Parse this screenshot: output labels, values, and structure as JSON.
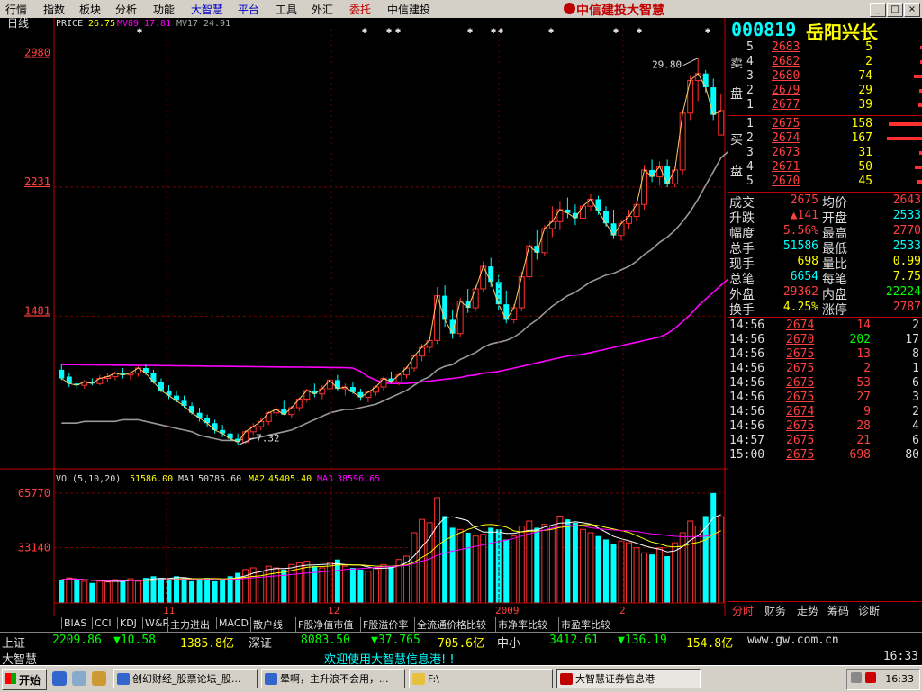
{
  "menu": {
    "items": [
      "行情",
      "指数",
      "板块",
      "分析",
      "功能",
      "大智慧",
      "平台",
      "工具",
      "外汇",
      "委托",
      "中信建投"
    ],
    "highlight": [
      "大智慧",
      "平台"
    ],
    "red": [
      "委托"
    ]
  },
  "brand": "中信建投大智慧",
  "window_buttons": [
    "_",
    "□",
    "×"
  ],
  "chart_header": {
    "period": "日线",
    "price_label": "PRICE",
    "price_value": "26.75",
    "ma89_label": "MV89",
    "ma89_value": "17.81",
    "ma17_label": "MV17",
    "ma17_value": "24.91"
  },
  "vol_header": {
    "label": "VOL(5,10,20)",
    "vol_value": "51586.00",
    "ma1_label": "MA1",
    "ma1_value": "50785.60",
    "ma2_label": "MA2",
    "ma2_value": "45405.40",
    "ma3_label": "MA3",
    "ma3_value": "38596.65"
  },
  "stock": {
    "code": "000819",
    "name": "岳阳兴长"
  },
  "order_book": {
    "sell_label": [
      "卖",
      "盘"
    ],
    "buy_label": [
      "买",
      "盘"
    ],
    "sell": [
      {
        "idx": "5",
        "price": "2683",
        "vol": "5",
        "bar": 0.03
      },
      {
        "idx": "4",
        "price": "2682",
        "vol": "2",
        "bar": 0.02
      },
      {
        "idx": "3",
        "price": "2680",
        "vol": "74",
        "bar": 0.25
      },
      {
        "idx": "2",
        "price": "2679",
        "vol": "29",
        "bar": 0.1
      },
      {
        "idx": "1",
        "price": "2677",
        "vol": "39",
        "bar": 0.12
      }
    ],
    "buy": [
      {
        "idx": "1",
        "price": "2675",
        "vol": "158",
        "bar": 0.95
      },
      {
        "idx": "2",
        "price": "2674",
        "vol": "167",
        "bar": 1.0
      },
      {
        "idx": "3",
        "price": "2673",
        "vol": "31",
        "bar": 0.1
      },
      {
        "idx": "4",
        "price": "2671",
        "vol": "50",
        "bar": 0.22
      },
      {
        "idx": "5",
        "price": "2670",
        "vol": "45",
        "bar": 0.18
      }
    ]
  },
  "stats": [
    {
      "l1": "成交",
      "v1": "2675",
      "c1": "#ff4040",
      "l2": "均价",
      "v2": "2643",
      "c2": "#ff4040"
    },
    {
      "l1": "升跌",
      "v1": "▲141",
      "c1": "#ff4040",
      "l2": "开盘",
      "v2": "2533",
      "c2": "#00ffff"
    },
    {
      "l1": "幅度",
      "v1": "5.56%",
      "c1": "#ff4040",
      "l2": "最高",
      "v2": "2770",
      "c2": "#ff4040"
    },
    {
      "l1": "总手",
      "v1": "51586",
      "c1": "#00ffff",
      "l2": "最低",
      "v2": "2533",
      "c2": "#00ffff"
    },
    {
      "l1": "现手",
      "v1": "698",
      "c1": "#ffff00",
      "l2": "量比",
      "v2": "0.99",
      "c2": "#ffff00"
    },
    {
      "l1": "总笔",
      "v1": "6654",
      "c1": "#00ffff",
      "l2": "每笔",
      "v2": "7.75",
      "c2": "#ffff00"
    },
    {
      "l1": "外盘",
      "v1": "29362",
      "c1": "#ff4040",
      "l2": "内盘",
      "v2": "22224",
      "c2": "#00ff00"
    },
    {
      "l1": "换手",
      "v1": "4.25%",
      "c1": "#ffff00",
      "l2": "涨停",
      "v2": "2787",
      "c2": "#ff4040"
    }
  ],
  "trades": [
    {
      "time": "14:56",
      "price": "2674",
      "vol": "14",
      "vc": "#ff4040",
      "cnt": "2"
    },
    {
      "time": "14:56",
      "price": "2670",
      "vol": "202",
      "vc": "#00ff00",
      "cnt": "17"
    },
    {
      "time": "14:56",
      "price": "2675",
      "vol": "13",
      "vc": "#ff4040",
      "cnt": "8"
    },
    {
      "time": "14:56",
      "price": "2675",
      "vol": "2",
      "vc": "#ff4040",
      "cnt": "1"
    },
    {
      "time": "14:56",
      "price": "2675",
      "vol": "53",
      "vc": "#ff4040",
      "cnt": "6"
    },
    {
      "time": "14:56",
      "price": "2675",
      "vol": "27",
      "vc": "#ff4040",
      "cnt": "3"
    },
    {
      "time": "14:56",
      "price": "2674",
      "vol": "9",
      "vc": "#ff4040",
      "cnt": "2"
    },
    {
      "time": "14:56",
      "price": "2675",
      "vol": "28",
      "vc": "#ff4040",
      "cnt": "4"
    },
    {
      "time": "14:57",
      "price": "2675",
      "vol": "21",
      "vc": "#ff4040",
      "cnt": "6"
    },
    {
      "time": "15:00",
      "price": "2675",
      "vol": "698",
      "vc": "#ff4040",
      "cnt": "80"
    }
  ],
  "side_tabs": [
    "分时",
    "财务",
    "走势",
    "筹码",
    "诊断"
  ],
  "indicator_tabs": [
    "BIAS",
    "CCI",
    "KDJ",
    "W&R",
    "主力进出",
    "MACD",
    "散户线",
    "F股净值市值",
    "F股溢价率",
    "全流通价格比较",
    "市净率比较",
    "市盈率比较"
  ],
  "ticker1": {
    "sh_label": "上证",
    "sh_index": "2209.86",
    "sh_change": "▼10.58",
    "sh_amount": "1385.8亿",
    "sz_label": "深证",
    "sz_index": "8083.50",
    "sz_change": "▼37.765",
    "sz_amount": "705.6亿",
    "zx_label": "中小",
    "zx_index": "3412.61",
    "zx_change": "▼136.19",
    "zx_amount": "154.8亿",
    "url": "www.gw.com.cn"
  },
  "ticker2": {
    "label": "大智慧",
    "message": "欢迎使用大智慧信息港! !",
    "time": "16:33"
  },
  "taskbar": {
    "start": "开始",
    "tasks": [
      "创幻财经_股票论坛_股...",
      "晕啊，主升浪不会用，...",
      "F:\\",
      "大智慧证券信息港"
    ],
    "clock": "16:33"
  },
  "chart_data": {
    "type": "candlestick",
    "title": "000819 岳阳兴长 日线",
    "y_ticks": [
      29.8,
      22.31,
      14.81
    ],
    "y_tick_labels": [
      "2980",
      "2231",
      "1481"
    ],
    "ylim": [
      6.0,
      31.5
    ],
    "x_tick_labels": [
      "11",
      "12",
      "2009",
      "2"
    ],
    "annotations": [
      {
        "text": "29.80",
        "type": "high"
      },
      {
        "text": "7.32",
        "type": "low"
      }
    ],
    "ohlc": [
      [
        11.7,
        12.0,
        11.1,
        11.2
      ],
      [
        11.3,
        11.5,
        10.7,
        10.9
      ],
      [
        10.9,
        11.0,
        10.6,
        10.8
      ],
      [
        10.8,
        11.1,
        10.6,
        11.0
      ],
      [
        11.0,
        11.2,
        10.8,
        10.9
      ],
      [
        10.9,
        11.4,
        10.8,
        11.2
      ],
      [
        11.2,
        11.5,
        11.0,
        11.3
      ],
      [
        11.3,
        11.6,
        11.1,
        11.5
      ],
      [
        11.5,
        11.8,
        11.2,
        11.4
      ],
      [
        11.4,
        11.6,
        11.1,
        11.5
      ],
      [
        11.5,
        11.9,
        11.3,
        11.8
      ],
      [
        11.8,
        12.0,
        11.4,
        11.5
      ],
      [
        11.5,
        11.7,
        10.9,
        11.0
      ],
      [
        11.0,
        11.2,
        10.4,
        10.5
      ],
      [
        10.5,
        10.8,
        10.0,
        10.2
      ],
      [
        10.2,
        10.5,
        9.8,
        9.9
      ],
      [
        9.9,
        10.2,
        9.5,
        9.6
      ],
      [
        9.6,
        9.8,
        9.1,
        9.2
      ],
      [
        9.2,
        9.5,
        8.7,
        8.9
      ],
      [
        8.9,
        9.1,
        8.4,
        8.6
      ],
      [
        8.6,
        8.8,
        8.0,
        8.2
      ],
      [
        8.2,
        8.5,
        7.8,
        8.0
      ],
      [
        8.0,
        8.2,
        7.5,
        7.7
      ],
      [
        7.7,
        8.0,
        7.32,
        7.5
      ],
      [
        7.5,
        8.2,
        7.4,
        8.1
      ],
      [
        8.1,
        8.6,
        7.9,
        8.4
      ],
      [
        8.4,
        8.9,
        8.2,
        8.7
      ],
      [
        8.7,
        9.3,
        8.5,
        9.2
      ],
      [
        9.2,
        9.6,
        9.0,
        9.4
      ],
      [
        9.4,
        9.9,
        9.1,
        9.1
      ],
      [
        9.1,
        9.6,
        8.9,
        9.5
      ],
      [
        9.5,
        10.1,
        9.3,
        10.0
      ],
      [
        10.0,
        10.6,
        9.8,
        10.5
      ],
      [
        10.5,
        10.9,
        10.1,
        10.3
      ],
      [
        10.3,
        10.8,
        10.0,
        10.6
      ],
      [
        10.6,
        11.2,
        10.4,
        11.1
      ],
      [
        11.1,
        11.4,
        10.5,
        10.6
      ],
      [
        10.6,
        10.9,
        10.2,
        10.7
      ],
      [
        10.7,
        11.0,
        10.3,
        10.4
      ],
      [
        10.4,
        10.6,
        9.9,
        10.1
      ],
      [
        10.1,
        10.5,
        9.8,
        10.4
      ],
      [
        10.4,
        10.8,
        10.2,
        10.7
      ],
      [
        10.7,
        11.3,
        10.5,
        11.2
      ],
      [
        11.2,
        11.6,
        10.9,
        11.0
      ],
      [
        11.0,
        11.5,
        10.8,
        11.4
      ],
      [
        11.4,
        11.9,
        11.2,
        11.8
      ],
      [
        11.8,
        12.6,
        11.6,
        12.5
      ],
      [
        12.5,
        13.2,
        12.2,
        13.0
      ],
      [
        13.0,
        13.6,
        12.7,
        13.4
      ],
      [
        13.4,
        16.5,
        13.2,
        16.0
      ],
      [
        16.0,
        16.6,
        14.2,
        14.6
      ],
      [
        14.6,
        15.2,
        13.5,
        13.8
      ],
      [
        13.8,
        15.9,
        13.6,
        15.7
      ],
      [
        15.7,
        16.4,
        15.0,
        15.3
      ],
      [
        15.3,
        16.6,
        15.1,
        16.4
      ],
      [
        16.4,
        18.0,
        16.2,
        17.7
      ],
      [
        17.7,
        18.2,
        16.5,
        16.8
      ],
      [
        16.8,
        17.2,
        15.2,
        15.5
      ],
      [
        15.5,
        16.3,
        14.4,
        14.6
      ],
      [
        14.6,
        15.5,
        14.4,
        15.3
      ],
      [
        15.3,
        17.4,
        15.1,
        17.1
      ],
      [
        17.1,
        19.2,
        16.9,
        18.9
      ],
      [
        18.9,
        19.8,
        18.1,
        18.5
      ],
      [
        18.5,
        20.1,
        18.3,
        19.9
      ],
      [
        19.9,
        21.2,
        19.4,
        20.3
      ],
      [
        20.3,
        21.5,
        19.8,
        21.0
      ],
      [
        21.0,
        21.7,
        20.5,
        20.8
      ],
      [
        20.8,
        21.3,
        20.1,
        20.5
      ],
      [
        20.5,
        21.4,
        20.2,
        21.2
      ],
      [
        21.2,
        21.9,
        20.9,
        21.6
      ],
      [
        21.6,
        21.8,
        20.7,
        20.9
      ],
      [
        20.9,
        21.2,
        20.0,
        20.2
      ],
      [
        20.2,
        21.0,
        19.3,
        19.5
      ],
      [
        19.5,
        20.4,
        19.2,
        20.2
      ],
      [
        20.2,
        21.0,
        19.9,
        20.6
      ],
      [
        20.6,
        21.5,
        20.3,
        21.3
      ],
      [
        21.3,
        23.6,
        21.0,
        23.3
      ],
      [
        23.3,
        23.9,
        22.6,
        22.9
      ],
      [
        22.9,
        23.8,
        22.4,
        23.5
      ],
      [
        23.5,
        23.9,
        22.3,
        22.5
      ],
      [
        22.5,
        23.5,
        22.3,
        23.3
      ],
      [
        23.3,
        26.8,
        23.0,
        26.6
      ],
      [
        26.6,
        28.8,
        26.2,
        28.5
      ],
      [
        28.5,
        29.8,
        27.3,
        28.9
      ],
      [
        28.9,
        29.1,
        27.8,
        28.1
      ],
      [
        28.1,
        28.6,
        26.2,
        26.5
      ],
      [
        25.33,
        27.7,
        25.33,
        26.75
      ]
    ],
    "ma17": [
      8.6,
      8.6,
      8.6,
      8.7,
      8.7,
      8.7,
      8.7,
      8.7,
      8.8,
      8.8,
      8.8,
      8.7,
      8.6,
      8.5,
      8.4,
      8.3,
      8.2,
      8.1,
      7.9,
      7.8,
      7.7,
      7.6,
      7.6,
      7.6,
      7.7,
      7.7,
      7.8,
      7.9,
      8.0,
      8.1,
      8.2,
      8.4,
      8.6,
      8.8,
      9.0,
      9.2,
      9.3,
      9.4,
      9.4,
      9.5,
      9.6,
      9.7,
      9.9,
      10.1,
      10.3,
      10.5,
      10.8,
      11.1,
      11.3,
      11.7,
      11.9,
      12.0,
      12.3,
      12.5,
      12.7,
      13.0,
      13.2,
      13.3,
      13.4,
      13.6,
      13.9,
      14.3,
      14.6,
      15.0,
      15.4,
      15.7,
      16.0,
      16.2,
      16.5,
      16.8,
      17.0,
      17.2,
      17.3,
      17.5,
      17.7,
      18.0,
      18.4,
      18.7,
      19.1,
      19.4,
      19.8,
      20.3,
      20.9,
      21.6,
      22.4,
      23.2,
      24.0,
      24.4,
      24.91
    ],
    "ma89": [
      12.0,
      12.0,
      12.0,
      11.99,
      11.99,
      11.98,
      11.98,
      11.97,
      11.97,
      11.96,
      11.96,
      11.95,
      11.95,
      11.94,
      11.94,
      11.93,
      11.93,
      11.92,
      11.92,
      11.91,
      11.91,
      11.9,
      11.9,
      11.89,
      11.89,
      11.88,
      11.88,
      11.87,
      11.87,
      11.86,
      11.86,
      11.85,
      11.85,
      11.84,
      11.84,
      11.83,
      11.83,
      11.82,
      11.8,
      11.6,
      11.3,
      11.1,
      10.95,
      10.9,
      10.9,
      10.9,
      10.95,
      11.0,
      11.05,
      11.1,
      11.15,
      11.2,
      11.25,
      11.35,
      11.4,
      11.5,
      11.55,
      11.6,
      11.7,
      11.8,
      11.9,
      12.0,
      12.1,
      12.2,
      12.3,
      12.4,
      12.5,
      12.55,
      12.6,
      12.7,
      12.8,
      12.9,
      13.0,
      13.1,
      13.2,
      13.3,
      13.4,
      13.5,
      13.6,
      13.8,
      14.1,
      14.5,
      14.9,
      15.4,
      15.8,
      16.2,
      16.6,
      17.0,
      17.81
    ],
    "volume": [
      14000,
      15000,
      14000,
      13000,
      12000,
      13000,
      12500,
      14000,
      13000,
      14500,
      13000,
      15000,
      16000,
      15000,
      14000,
      16000,
      15000,
      13000,
      14000,
      15000,
      13000,
      14000,
      16000,
      18000,
      20000,
      21000,
      19000,
      22000,
      21000,
      20000,
      23000,
      24000,
      25000,
      22000,
      21000,
      24000,
      26000,
      22000,
      21000,
      20000,
      19000,
      21000,
      23000,
      22000,
      26000,
      28000,
      42000,
      50000,
      48000,
      63000,
      52000,
      45000,
      44000,
      42000,
      40000,
      41000,
      45000,
      44000,
      38000,
      40000,
      46000,
      49000,
      45000,
      47000,
      46000,
      52000,
      50000,
      48000,
      44000,
      42000,
      40000,
      38000,
      35000,
      37000,
      36000,
      33000,
      30000,
      29000,
      33000,
      28000,
      36000,
      42000,
      49000,
      46000,
      52000,
      65770,
      51586
    ],
    "vol_up": [
      0,
      1,
      0,
      1,
      0,
      1,
      1,
      1,
      0,
      1,
      1,
      0,
      0,
      0,
      0,
      0,
      0,
      0,
      0,
      0,
      0,
      0,
      0,
      0,
      1,
      1,
      1,
      1,
      1,
      0,
      1,
      1,
      1,
      0,
      1,
      1,
      0,
      1,
      0,
      0,
      1,
      1,
      1,
      0,
      1,
      1,
      1,
      1,
      1,
      1,
      0,
      0,
      1,
      0,
      1,
      1,
      0,
      0,
      0,
      1,
      1,
      1,
      0,
      1,
      1,
      1,
      0,
      0,
      1,
      1,
      0,
      0,
      0,
      1,
      1,
      1,
      1,
      0,
      1,
      0,
      1,
      1,
      1,
      1,
      0,
      0,
      1
    ],
    "vol_ticks": [
      65770,
      33140
    ]
  }
}
